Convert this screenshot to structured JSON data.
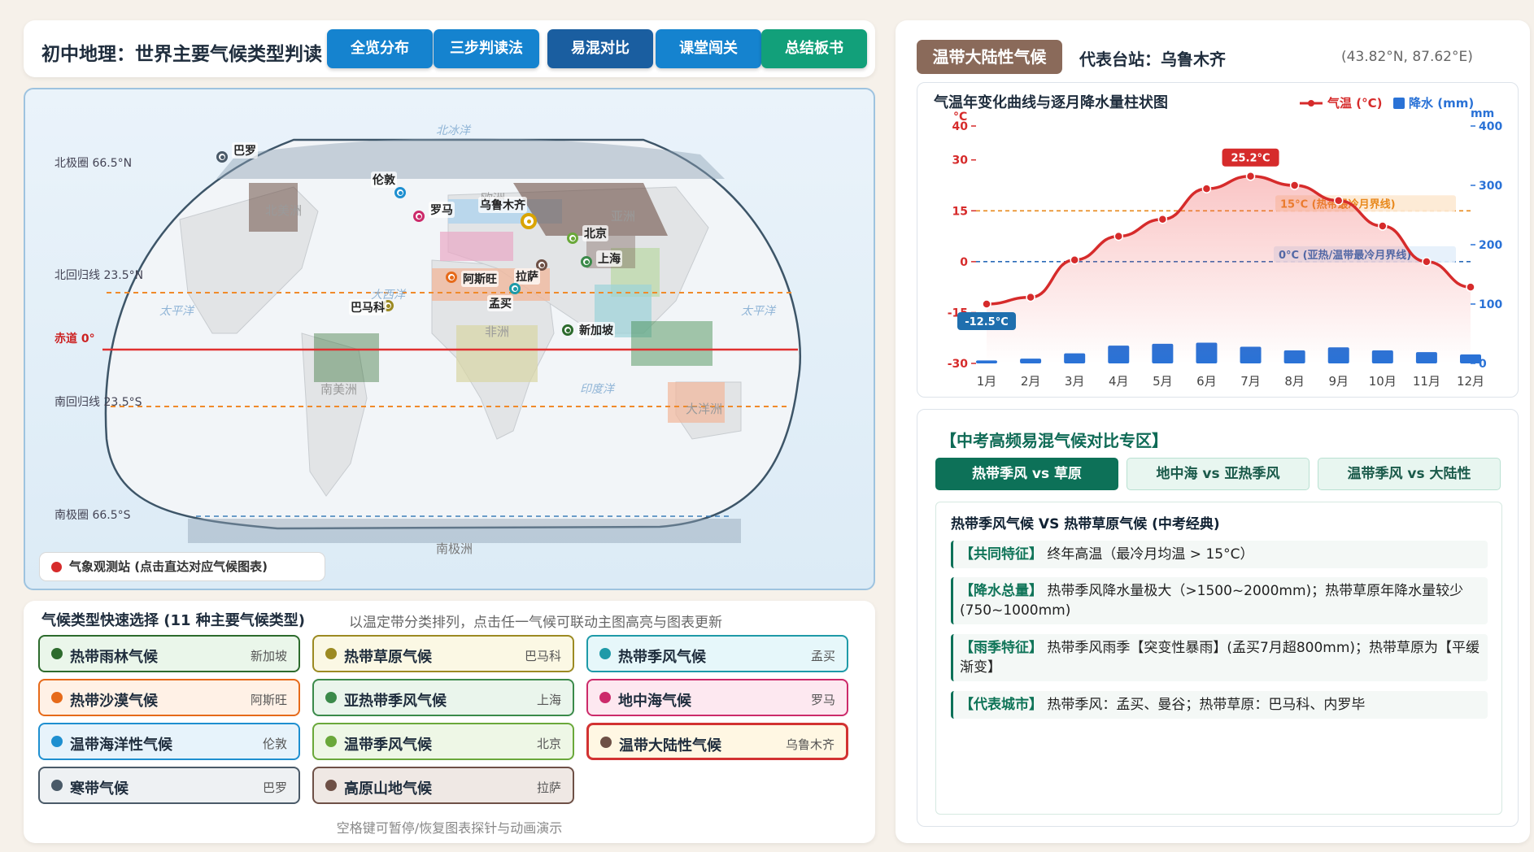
{
  "header": {
    "title": "初中地理：世界主要气候类型判读",
    "nav": [
      "全览分布",
      "三步判读法",
      "易混对比",
      "课堂闯关",
      "总结板书"
    ]
  },
  "map": {
    "lines": {
      "arctic": "北极圈 66.5°N",
      "tropic_n": "北回归线 23.5°N",
      "equator": "赤道 0°",
      "tropic_s": "南回归线 23.5°S",
      "antarctic": "南极圈 66.5°S"
    },
    "regions": [
      "北冰洋",
      "北美洲",
      "欧洲",
      "亚洲",
      "大西洋",
      "太平洋",
      "太平洋",
      "非洲",
      "南美洲",
      "印度洋",
      "大洋洲",
      "南极洲"
    ],
    "stations": [
      {
        "name": "巴罗",
        "color": "#4a5a68"
      },
      {
        "name": "伦敦",
        "color": "#1e8fd0"
      },
      {
        "name": "罗马",
        "color": "#cc2a6a"
      },
      {
        "name": "乌鲁木齐",
        "color": "#d9a400"
      },
      {
        "name": "北京",
        "color": "#6aa83a"
      },
      {
        "name": "上海",
        "color": "#3b8a4a"
      },
      {
        "name": "拉萨",
        "color": "#6e5046"
      },
      {
        "name": "阿斯旺",
        "color": "#e66a1a"
      },
      {
        "name": "孟买",
        "color": "#1e9aa8"
      },
      {
        "name": "巴马科",
        "color": "#9c8a22"
      },
      {
        "name": "新加坡",
        "color": "#2d6b2d"
      }
    ],
    "legend": "气象观测站 (点击直达对应气候图表)"
  },
  "selector": {
    "title": "气候类型快速选择 (11 种主要气候类型)",
    "subtitle": "以温定带分类排列，点击任一气候可联动主图高亮与图表更新",
    "items": [
      {
        "name": "热带雨林气候",
        "city": "新加坡",
        "color": "#2d6b2d"
      },
      {
        "name": "热带草原气候",
        "city": "巴马科",
        "color": "#9c8a22"
      },
      {
        "name": "热带季风气候",
        "city": "孟买",
        "color": "#1e9aa8"
      },
      {
        "name": "热带沙漠气候",
        "city": "阿斯旺",
        "color": "#e66a1a"
      },
      {
        "name": "亚热带季风气候",
        "city": "上海",
        "color": "#3b8a4a"
      },
      {
        "name": "地中海气候",
        "city": "罗马",
        "color": "#cc2a6a"
      },
      {
        "name": "温带海洋性气候",
        "city": "伦敦",
        "color": "#1e8fd0"
      },
      {
        "name": "温带季风气候",
        "city": "北京",
        "color": "#6aa83a"
      },
      {
        "name": "温带大陆性气候",
        "city": "乌鲁木齐",
        "color": "#6e5046"
      },
      {
        "name": "寒带气候",
        "city": "巴罗",
        "color": "#4a5a68"
      },
      {
        "name": "高原山地气候",
        "city": "拉萨",
        "color": "#6e5046"
      }
    ],
    "footer": "空格键可暂停/恢复图表探针与动画演示"
  },
  "climate_panel": {
    "tag": "温带大陆性气候",
    "station": "代表台站：乌鲁木齐",
    "coords": "(43.82°N, 87.62°E)"
  },
  "chart_data": {
    "type": "line",
    "title": "气温年变化曲线与逐月降水量柱状图",
    "categories": [
      "1月",
      "2月",
      "3月",
      "4月",
      "5月",
      "6月",
      "7月",
      "8月",
      "9月",
      "10月",
      "11月",
      "12月"
    ],
    "series": [
      {
        "name": "气温 (°C)",
        "values": [
          -12.5,
          -10.5,
          0.5,
          7.5,
          12.5,
          21.5,
          25.2,
          22.5,
          18,
          10.5,
          0,
          -7.5
        ],
        "color": "#d62b2b"
      },
      {
        "name": "降水 (mm)",
        "values": [
          5,
          8,
          17,
          30,
          33,
          35,
          28,
          22,
          27,
          22,
          19,
          15
        ],
        "color": "#2a72d6",
        "type": "bar"
      }
    ],
    "y_left": {
      "unit": "°C",
      "ticks": [
        40,
        30,
        15,
        0,
        -15,
        -30
      ],
      "ylim": [
        -30,
        40
      ]
    },
    "y_right": {
      "unit": "mm",
      "ticks": [
        400,
        300,
        200,
        100,
        0
      ],
      "ylim": [
        0,
        400
      ]
    },
    "ref_lines": [
      {
        "value": 15,
        "label": "15°C (热带最冷月界线)"
      },
      {
        "value": 0,
        "label": "0°C (亚热/温带最冷月界线)"
      }
    ],
    "max_label": "25.2°C",
    "min_label": "-12.5°C"
  },
  "compare": {
    "title": "【中考高频易混气候对比专区】",
    "tabs": [
      "热带季风 vs 草原",
      "地中海 vs 亚热季风",
      "温带季风 vs 大陆性"
    ],
    "detail_title": "热带季风气候 VS 热带草原气候 (中考经典)",
    "rows": [
      {
        "k": "【共同特征】",
        "v": "终年高温（最冷月均温 > 15°C）"
      },
      {
        "k": "【降水总量】",
        "v": "热带季风降水量极大（>1500~2000mm)；热带草原年降水量较少(750~1000mm)"
      },
      {
        "k": "【雨季特征】",
        "v": "热带季风雨季【突变性暴雨】(孟买7月超800mm)；热带草原为【平缓渐变】"
      },
      {
        "k": "【代表城市】",
        "v": "热带季风：孟买、曼谷；热带草原：巴马科、内罗毕"
      }
    ]
  },
  "colors": {
    "accent": "#1583cf",
    "nav_active": "#1a5ea0",
    "nav_summary": "#12a07a",
    "teal": "#0d7158"
  }
}
